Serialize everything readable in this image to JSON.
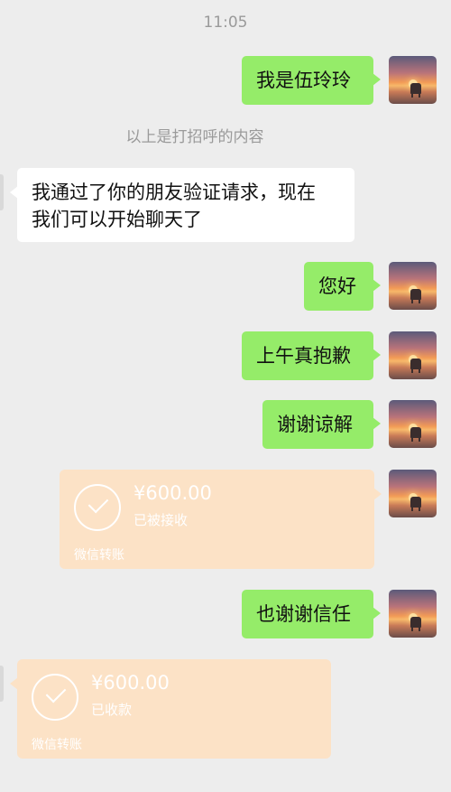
{
  "header": {
    "time": "11:05"
  },
  "system_notice": "以上是打招呼的内容",
  "messages": [
    {
      "text": "我是伍玲玲"
    },
    {
      "text": "我通过了你的朋友验证请求，现在",
      "text2": "我们可以开始聊天了"
    },
    {
      "text": "您好"
    },
    {
      "text": "上午真抱歉"
    },
    {
      "text": "谢谢谅解"
    },
    {
      "amount": "¥600.00",
      "status": "已被接收",
      "source": "微信转账"
    },
    {
      "text": "也谢谢信任"
    },
    {
      "amount": "¥600.00",
      "status": "已收款",
      "source": "微信转账"
    }
  ],
  "colors": {
    "background": "#ededed",
    "outgoing_bubble": "#95ec69",
    "incoming_bubble": "#ffffff",
    "transfer_card": "#fce2c6"
  },
  "icons": [
    "avatar-sunset-horse",
    "check-circle-icon"
  ]
}
